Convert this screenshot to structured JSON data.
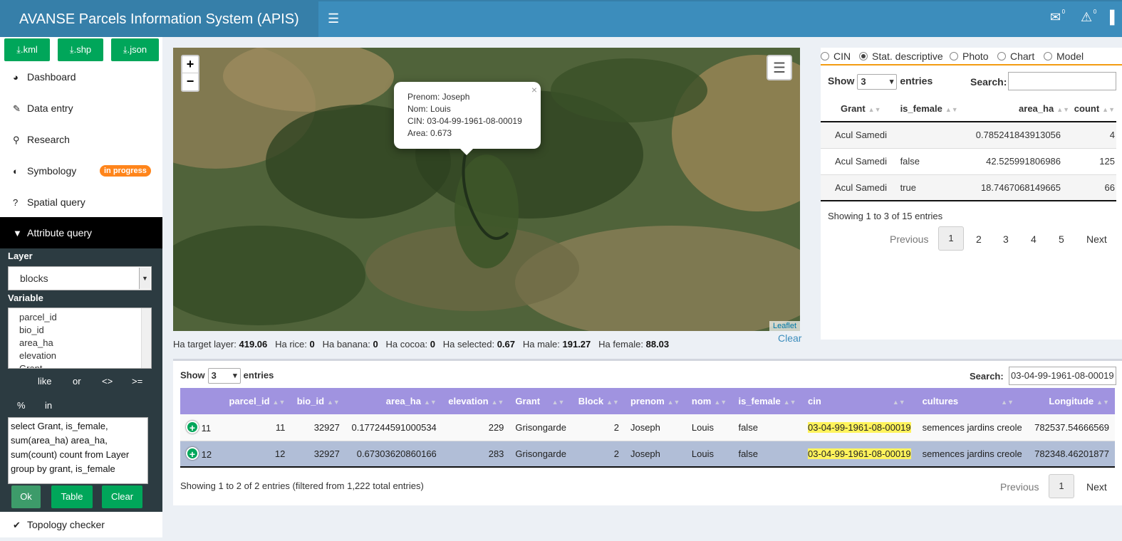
{
  "header": {
    "title": "AVANSE Parcels Information System (APIS)",
    "mail_count": "0",
    "alert_count": "0"
  },
  "sidebar": {
    "downloads": [
      ".kml",
      ".shp",
      ".json"
    ],
    "nav": [
      "Dashboard",
      "Data entry",
      "Research",
      "Symbology",
      "Spatial query",
      "Attribute query",
      "Topology checker"
    ],
    "symbology_badge": "in progress",
    "layer_label": "Layer",
    "layer_value": "blocks",
    "variable_label": "Variable",
    "variables": [
      "parcel_id",
      "bio_id",
      "area_ha",
      "elevation",
      "Grant"
    ],
    "operators": [
      "like",
      "or",
      "<>",
      ">=",
      "%",
      "in"
    ],
    "sql": "select Grant, is_female, sum(area_ha) area_ha, sum(count) count from Layer group by grant, is_female",
    "buttons": {
      "ok": "Ok",
      "table": "Table",
      "clear": "Clear"
    }
  },
  "map": {
    "popup": {
      "prenom": "Prenom: Joseph",
      "nom": "Nom: Louis",
      "cin": "CIN: 03-04-99-1961-08-00019",
      "area": "Area: 0.673"
    },
    "attribution": "Leaflet",
    "zoom_in": "+",
    "zoom_out": "−"
  },
  "stats": {
    "labels": [
      "Ha target layer:",
      "Ha rice:",
      "Ha banana:",
      "Ha cocoa:",
      "Ha selected:",
      "Ha male:",
      "Ha female:"
    ],
    "values": [
      "419.06",
      "0",
      "0",
      "0",
      "0.67",
      "191.27",
      "88.03"
    ],
    "clear": "Clear"
  },
  "right": {
    "radios": [
      "CIN",
      "Stat. descriptive",
      "Photo",
      "Chart",
      "Model"
    ],
    "show": "Show",
    "entries": "entries",
    "page_size": "3",
    "search": "Search:",
    "columns": [
      "Grant",
      "is_female",
      "area_ha",
      "count"
    ],
    "rows": [
      [
        "Acul Samedi",
        "",
        "0.785241843913056",
        "4"
      ],
      [
        "Acul Samedi",
        "false",
        "42.525991806986",
        "125"
      ],
      [
        "Acul Samedi",
        "true",
        "18.7467068149665",
        "66"
      ]
    ],
    "info": "Showing 1 to 3 of 15 entries",
    "pagination": [
      "Previous",
      "1",
      "2",
      "3",
      "4",
      "5",
      "Next"
    ]
  },
  "bottom": {
    "show": "Show",
    "entries": "entries",
    "page_size": "3",
    "search": "Search:",
    "search_value": "03-04-99-1961-08-00019",
    "columns": [
      "",
      "parcel_id",
      "bio_id",
      "area_ha",
      "elevation",
      "Grant",
      "Block",
      "prenom",
      "nom",
      "is_female",
      "cin",
      "cultures",
      "Longitude"
    ],
    "rows": [
      [
        "11",
        "11",
        "32927",
        "0.177244591000534",
        "229",
        "Grisongarde",
        "2",
        "Joseph",
        "Louis",
        "false",
        "03-04-99-1961-08-00019",
        "semences jardins creole",
        "782537.54666569"
      ],
      [
        "12",
        "12",
        "32927",
        "0.67303620860166",
        "283",
        "Grisongarde",
        "2",
        "Joseph",
        "Louis",
        "false",
        "03-04-99-1961-08-00019",
        "semences jardins creole",
        "782348.46201877"
      ]
    ],
    "info": "Showing 1 to 2 of 2 entries (filtered from 1,222 total entries)",
    "pagination": [
      "Previous",
      "1",
      "Next"
    ]
  },
  "colors": {
    "header": "#3c8dbc",
    "brand": "#367fa9",
    "green": "#00a65a",
    "badge": "#ff851b",
    "table_header": "#a093e0",
    "highlight": "#fff35c"
  }
}
